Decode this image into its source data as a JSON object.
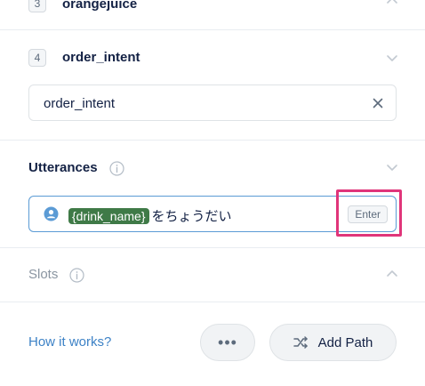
{
  "steps": [
    {
      "number": "3",
      "name": "orangejuice"
    },
    {
      "number": "4",
      "name": "order_intent"
    }
  ],
  "intent_input": {
    "value": "order_intent"
  },
  "utterances": {
    "title": "Utterances",
    "entity": "{drink_name}",
    "text": "をちょうだい",
    "enter_label": "Enter"
  },
  "slots": {
    "title": "Slots"
  },
  "footer": {
    "help_link": "How it works?",
    "more_label": "•••",
    "add_path_label": "Add Path"
  },
  "colors": {
    "accent": "#5b9bd5",
    "entity": "#3f7a47",
    "highlight": "#e0357a",
    "link": "#3d82c6"
  }
}
